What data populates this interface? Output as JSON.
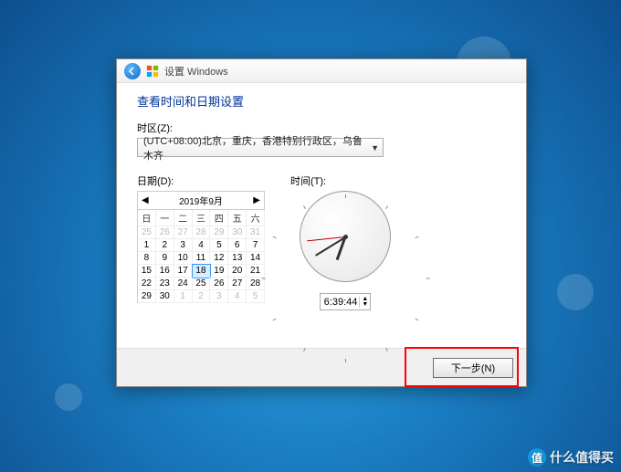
{
  "header": {
    "app_title": "设置 Windows"
  },
  "main": {
    "heading": "查看时间和日期设置",
    "timezone_label": "时区(Z):",
    "timezone_value": "(UTC+08:00)北京，重庆，香港特别行政区，乌鲁木齐",
    "date_label": "日期(D):",
    "time_label": "时间(T):"
  },
  "calendar": {
    "title": "2019年9月",
    "days_of_week": [
      "日",
      "一",
      "二",
      "三",
      "四",
      "五",
      "六"
    ],
    "leading": [
      25,
      26,
      27,
      28,
      29,
      30,
      31
    ],
    "days": [
      1,
      2,
      3,
      4,
      5,
      6,
      7,
      8,
      9,
      10,
      11,
      12,
      13,
      14,
      15,
      16,
      17,
      18,
      19,
      20,
      21,
      22,
      23,
      24,
      25,
      26,
      27,
      28,
      29,
      30
    ],
    "trailing": [
      1,
      2,
      3,
      4,
      5
    ],
    "selected": 18
  },
  "clock": {
    "time_text": "6:39:44",
    "hours": 6,
    "minutes": 39,
    "seconds": 44
  },
  "footer": {
    "next_label": "下一步(N)"
  },
  "watermark": {
    "badge": "值",
    "text": "什么值得买"
  }
}
